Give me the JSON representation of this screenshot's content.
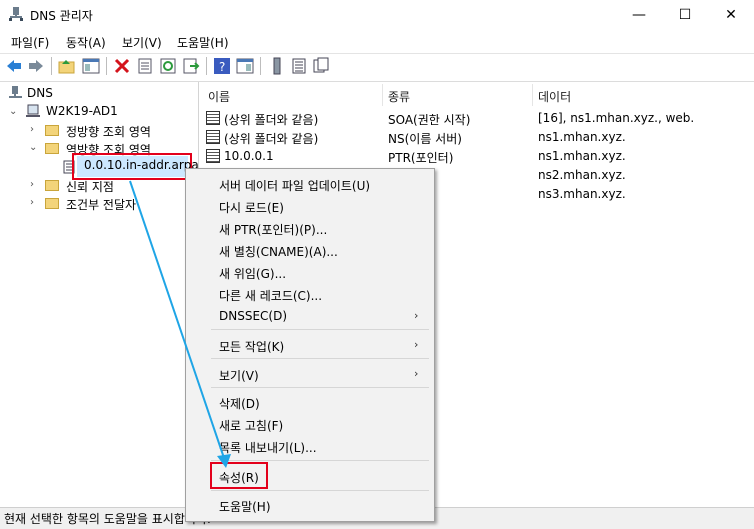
{
  "window": {
    "title": "DNS 관리자",
    "minimize": "—",
    "maximize": "☐",
    "close": "✕"
  },
  "menu": [
    "파일(F)",
    "동작(A)",
    "보기(V)",
    "도움말(H)"
  ],
  "tree": {
    "root": "DNS",
    "server": "W2K19-AD1",
    "forward": "정방향 조회 영역",
    "reverse": "역방향 조회 영역",
    "zone": "0.0.10.in-addr.arpa",
    "trust": "신뢰 지점",
    "conditional": "조건부 전달자"
  },
  "columns": [
    "이름",
    "종류",
    "데이터"
  ],
  "rows": [
    {
      "name": "(상위 폴더와 같음)",
      "type": "SOA(권한 시작)",
      "data": "[16], ns1.mhan.xyz., web."
    },
    {
      "name": "(상위 폴더와 같음)",
      "type": "NS(이름 서버)",
      "data": "ns1.mhan.xyz."
    },
    {
      "name": "10.0.0.1",
      "type": "PTR(포인터)",
      "data": "ns1.mhan.xyz."
    },
    {
      "name": "",
      "type": "",
      "data": "ns2.mhan.xyz."
    },
    {
      "name": "",
      "type": "",
      "data": "ns3.mhan.xyz."
    }
  ],
  "context_menu": {
    "update": "서버 데이터 파일 업데이트(U)",
    "reload": "다시 로드(E)",
    "new_ptr": "새 PTR(포인터)(P)...",
    "new_cname": "새 별칭(CNAME)(A)...",
    "new_delegation": "새 위임(G)...",
    "other_records": "다른 새 레코드(C)...",
    "dnssec": "DNSSEC(D)",
    "all_tasks": "모든 작업(K)",
    "view": "보기(V)",
    "delete": "삭제(D)",
    "refresh": "새로 고침(F)",
    "export": "목록 내보내기(L)...",
    "properties": "속성(R)",
    "help": "도움말(H)"
  },
  "status": "현재 선택한 항목의 도움말을 표시합니다.",
  "colors": {
    "highlight": "#e3001b",
    "arrow": "#1fa5e6",
    "selection": "#cce8ff"
  }
}
